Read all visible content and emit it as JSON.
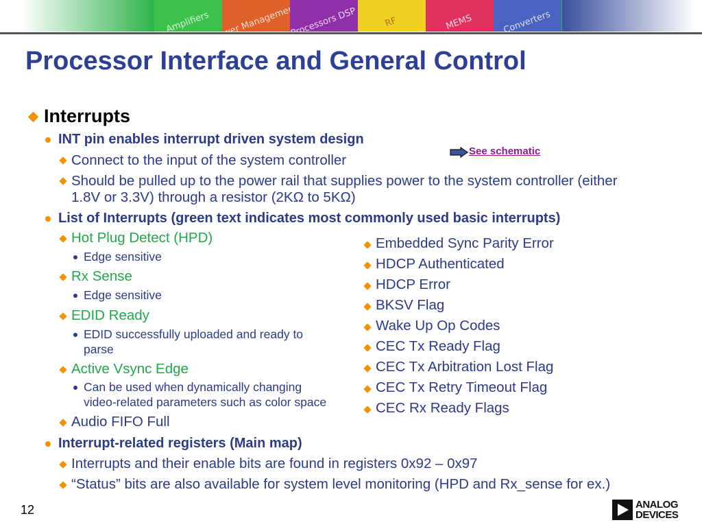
{
  "banner": {
    "tiles": [
      {
        "label": "Amplifiers",
        "color": "#3cc24a"
      },
      {
        "label": "Power Management",
        "color": "#e0602a"
      },
      {
        "label": "Processors DSP",
        "color": "#9030a8"
      },
      {
        "label": "RF",
        "color": "#f0d020"
      },
      {
        "label": "MEMS",
        "color": "#e03060"
      },
      {
        "label": "Converters",
        "color": "#4a62c0"
      }
    ]
  },
  "title": "Processor Interface and General Control",
  "link": "See schematic",
  "lines": [
    "Interrupts",
    "INT pin enables interrupt driven system design",
    "Connect to the input of the system controller",
    "Should be pulled up to the power rail that supplies power to the system controller (either",
    "1.8V or 3.3V) through a resistor (2KΩ to 5KΩ)",
    "List of Interrupts (green text indicates most commonly used basic interrupts)",
    "Hot Plug Detect (HPD)",
    "Edge sensitive",
    "Rx Sense",
    "Edge sensitive",
    "EDID Ready",
    "EDID successfully uploaded and ready to",
    "parse",
    "Active Vsync Edge",
    "Can be used when dynamically changing",
    "video-related parameters such as color space",
    "Audio FIFO Full",
    "Interrupt-related registers (Main map)",
    "Interrupts and their enable bits are found in registers 0x92 – 0x97",
    "“Status” bits are also available for system level monitoring (HPD and Rx_sense for ex.)"
  ],
  "right_list": [
    "Embedded Sync Parity Error",
    "HDCP Authenticated",
    "HDCP Error",
    "BKSV Flag",
    "Wake Up Op Codes",
    "CEC Tx Ready Flag",
    "CEC Tx Arbitration Lost Flag",
    "CEC Tx Retry Timeout Flag",
    "CEC Rx Ready Flags"
  ],
  "page_number": "12",
  "logo": {
    "line1": "ANALOG",
    "line2": "DEVICES"
  },
  "colors": {
    "title": "#2e3f96",
    "body": "#2b3a8a",
    "highlight_green": "#22a84a",
    "bullet": "#f39200",
    "link": "#8b1a8b"
  }
}
